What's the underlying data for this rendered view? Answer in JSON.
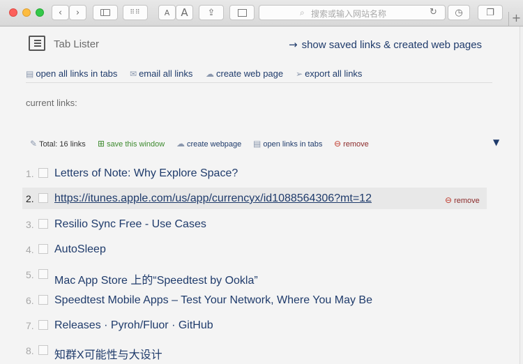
{
  "browser": {
    "address_placeholder": "搜索或输入网站名称",
    "colors": {
      "close": "#fc605c",
      "minimize": "#fdbc40",
      "zoom": "#34c84a"
    },
    "reader_label_small": "A",
    "reader_label_large": "A"
  },
  "header": {
    "app_title": "Tab Lister",
    "saved_links_label": "show saved links & created web pages"
  },
  "actions": {
    "open_all": "open all links in tabs",
    "email_all": "email all links",
    "create_web_page": "create web page",
    "export_all": "export all links"
  },
  "section_label": "current links:",
  "window": {
    "total": "Total: 16 links",
    "save": "save this window",
    "create": "create webpage",
    "open": "open links in tabs",
    "remove": "remove"
  },
  "links": [
    {
      "num": "1.",
      "title": "Letters of Note: Why Explore Space?"
    },
    {
      "num": "2.",
      "title": "https://itunes.apple.com/us/app/currencyx/id1088564306?mt=12",
      "remove": "remove"
    },
    {
      "num": "3.",
      "title": "Resilio Sync Free - Use Cases"
    },
    {
      "num": "4.",
      "title": "AutoSleep"
    },
    {
      "num": "5.",
      "title": "Mac App Store 上的“Speedtest by Ookla”"
    },
    {
      "num": "6.",
      "title": "Speedtest Mobile Apps – Test Your Network, Where You May Be"
    },
    {
      "num": "7.",
      "title": "Releases · Pyroh/Fluor · GitHub"
    },
    {
      "num": "8.",
      "title": "知群X可能性与大设计"
    }
  ]
}
